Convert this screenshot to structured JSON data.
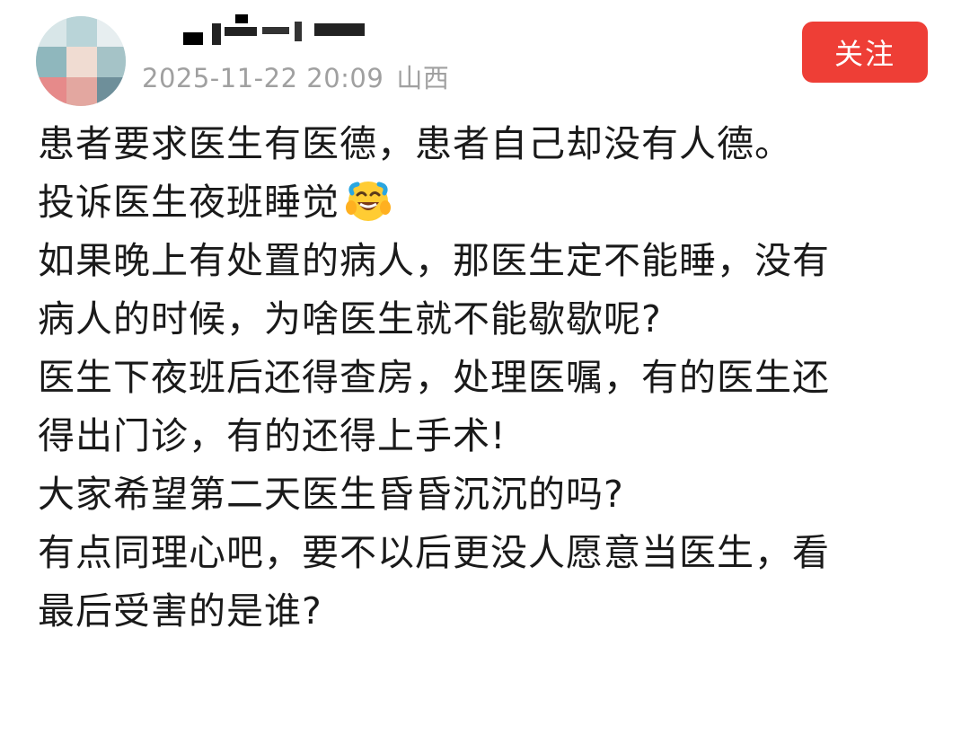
{
  "post": {
    "author": {
      "avatar_icon": "pixelated-avatar-icon",
      "name_redacted": true
    },
    "timestamp": "2025-11-22 20:09",
    "location": "山西",
    "follow_label": "关注",
    "accent_color": "#ee3e36",
    "content_lines": [
      "患者要求医生有医德，患者自己却没有人德。",
      "投诉医生夜班睡觉",
      "如果晚上有处置的病人，那医生定不能睡，没有",
      "病人的时候，为啥医生就不能歇歇呢?",
      "医生下夜班后还得查房，处理医嘱，有的医生还",
      "得出门诊，有的还得上手术!",
      "大家希望第二天医生昏昏沉沉的吗?",
      "有点同理心吧，要不以后更没人愿意当医生，看",
      "最后受害的是谁?"
    ],
    "emoji": "laughing-crying-emoji"
  }
}
